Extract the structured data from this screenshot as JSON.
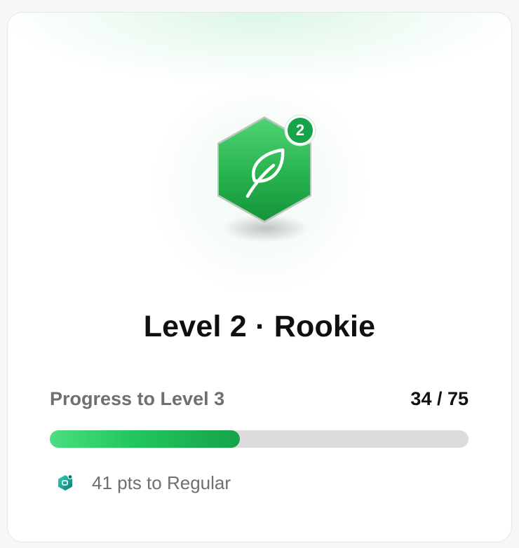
{
  "level": {
    "current": "2",
    "badge_number": "2",
    "title": "Level 2 · Rookie",
    "badge_icon": "leaf-icon",
    "badge_color": "#16a34a"
  },
  "progress": {
    "label": "Progress to Level 3",
    "value_text": "34 / 75",
    "current": 34,
    "target": 75,
    "bar_color": "#22c55e"
  },
  "next_tier": {
    "icon": "gem-icon",
    "text": "41 pts to Regular"
  }
}
